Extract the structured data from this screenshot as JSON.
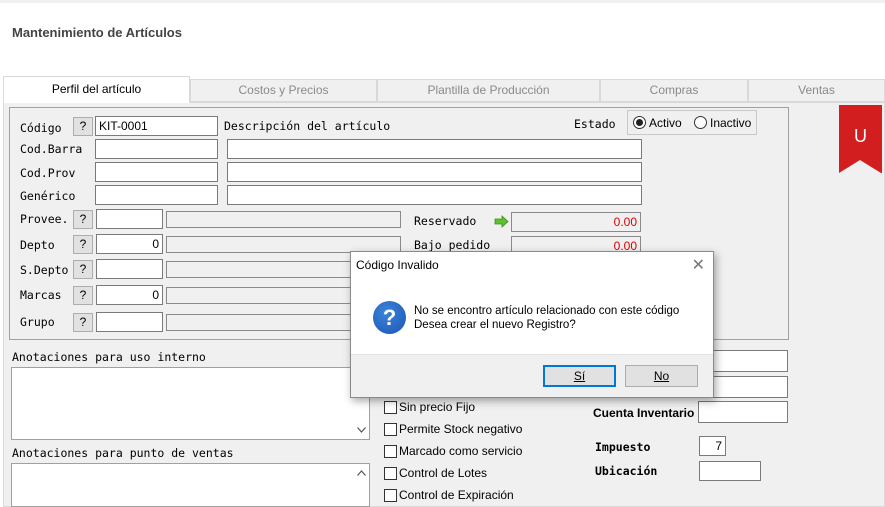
{
  "window": {
    "title": "Mantenimiento de Artículos"
  },
  "tabs": [
    {
      "label": "Perfil del artículo",
      "active": true
    },
    {
      "label": "Costos y Precios"
    },
    {
      "label": "Plantilla de Producción"
    },
    {
      "label": "Compras"
    },
    {
      "label": "Ventas"
    }
  ],
  "form": {
    "codigo_label": "Código",
    "codigo_value": "KIT-0001",
    "descripcion_label": "Descripción del artículo",
    "codbarra_label": "Cod.Barra",
    "codprov_label": "Cod.Prov",
    "generico_label": "Genérico",
    "provee_label": "Provee.",
    "depto_label": "Depto",
    "depto_value": "0",
    "sdepto_label": "S.Depto",
    "marcas_label": "Marcas",
    "marcas_value": "0",
    "grupo_label": "Grupo",
    "help_button": "?",
    "estado_label": "Estado",
    "activo_label": "Activo",
    "inactivo_label": "Inactivo",
    "reservado_label": "Reservado",
    "reservado_value": "0.00",
    "bajo_pedido_label": "Bajo pedido",
    "bajo_pedido_value": "0.00"
  },
  "ribbon": {
    "letter": "U",
    "color": "#d21e1e"
  },
  "notes": {
    "internal_label": "Anotaciones para uso interno",
    "pos_label": "Anotaciones para punto de ventas"
  },
  "options": [
    {
      "label": "Sin precio Fijo"
    },
    {
      "label": "Permite Stock negativo"
    },
    {
      "label": "Marcado como servicio"
    },
    {
      "label": "Control de Lotes"
    },
    {
      "label": "Control de Expiración"
    }
  ],
  "right_fields": {
    "cuenta_inventario_label": "Cuenta Inventario",
    "impuesto_label": "Impuesto",
    "impuesto_value": "7",
    "ubicacion_label": "Ubicación"
  },
  "dialog": {
    "title": "Código Invalido",
    "message_line1": "No se encontro artículo relacionado con este código",
    "message_line2": "Desea crear el nuevo Registro?",
    "yes_label": "Sí",
    "no_label": "No",
    "icon": "question-icon"
  }
}
